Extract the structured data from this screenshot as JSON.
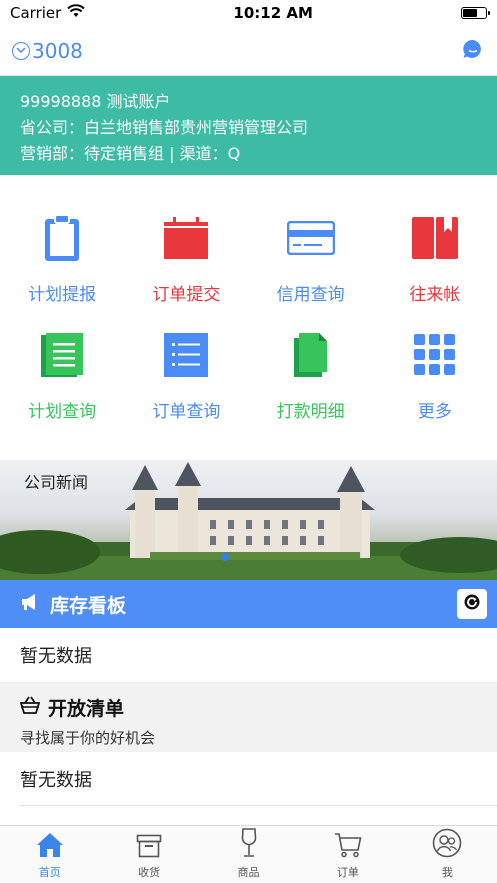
{
  "status_bar": {
    "carrier": "Carrier",
    "time": "10:12 AM"
  },
  "nav": {
    "account_code": "3008"
  },
  "account": {
    "line1": "99998888 测试账户",
    "line2": "省公司：白兰地销售部贵州营销管理公司",
    "line3": "营销部：待定销售组 | 渠道：Q"
  },
  "grid": [
    {
      "label": "计划提报",
      "color": "#4a8bf5",
      "icon": "clipboard-icon"
    },
    {
      "label": "订单提交",
      "color": "#e8383d",
      "icon": "calendar-icon"
    },
    {
      "label": "信用查询",
      "color": "#4a8bf5",
      "icon": "credit-card-icon"
    },
    {
      "label": "往来帐",
      "color": "#e8383d",
      "icon": "book-icon"
    },
    {
      "label": "计划查询",
      "color": "#36c45b",
      "icon": "document-icon"
    },
    {
      "label": "订单查询",
      "color": "#4a8bf5",
      "icon": "list-icon"
    },
    {
      "label": "打款明细",
      "color": "#36c45b",
      "icon": "files-icon"
    },
    {
      "label": "更多",
      "color": "#4a8bf5",
      "icon": "grid-icon"
    }
  ],
  "news": {
    "title": "公司新闻"
  },
  "inventory": {
    "title": "库存看板",
    "empty_text": "暂无数据"
  },
  "open_list": {
    "title": "开放清单",
    "subtitle": "寻找属于你的好机会",
    "empty_text": "暂无数据"
  },
  "tabs": [
    {
      "label": "首页",
      "icon": "home-icon",
      "active": true
    },
    {
      "label": "收货",
      "icon": "box-icon",
      "active": false
    },
    {
      "label": "商品",
      "icon": "wine-glass-icon",
      "active": false
    },
    {
      "label": "订单",
      "icon": "cart-icon",
      "active": false
    },
    {
      "label": "我",
      "icon": "user-icon",
      "active": false
    }
  ],
  "colors": {
    "accent_blue": "#4a8bf5",
    "teal": "#3dbba5",
    "red": "#e8383d",
    "green": "#36c45b"
  }
}
